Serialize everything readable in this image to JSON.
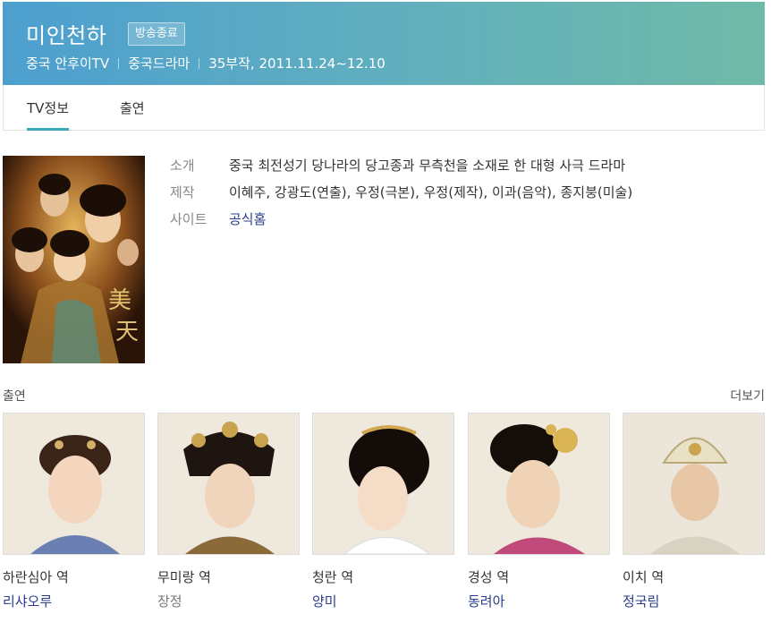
{
  "header": {
    "title": "미인천하",
    "badge": "방송종료",
    "meta": [
      "중국 안후이TV",
      "중국드라마",
      "35부작, 2011.11.24~12.10"
    ]
  },
  "tabs": [
    {
      "label": "TV정보",
      "active": true
    },
    {
      "label": "출연",
      "active": false
    }
  ],
  "info": {
    "intro_key": "소개",
    "intro_val": "중국 최전성기 당나라의 당고종과 무측천을 소재로 한 대형 사극 드라마",
    "prod_key": "제작",
    "prod_val": "이혜주, 강광도(연출), 우정(극본), 우정(제작), 이과(음악), 종지붕(미술)",
    "site_key": "사이트",
    "site_val": "공식홈"
  },
  "cast": {
    "label": "출연",
    "more": "더보기",
    "members": [
      {
        "role": "하란심아 역",
        "actor": "리샤오루",
        "linked": true
      },
      {
        "role": "무미랑 역",
        "actor": "장정",
        "linked": false
      },
      {
        "role": "청란 역",
        "actor": "양미",
        "linked": true
      },
      {
        "role": "경성 역",
        "actor": "동려아",
        "linked": true
      },
      {
        "role": "이치 역",
        "actor": "정국림",
        "linked": true
      }
    ]
  },
  "colors": {
    "header_gradient_start": "#4d9fcf",
    "header_gradient_end": "#6fbaa7",
    "tab_active_underline": "#3aa9b5",
    "link": "#2b3c8c"
  }
}
